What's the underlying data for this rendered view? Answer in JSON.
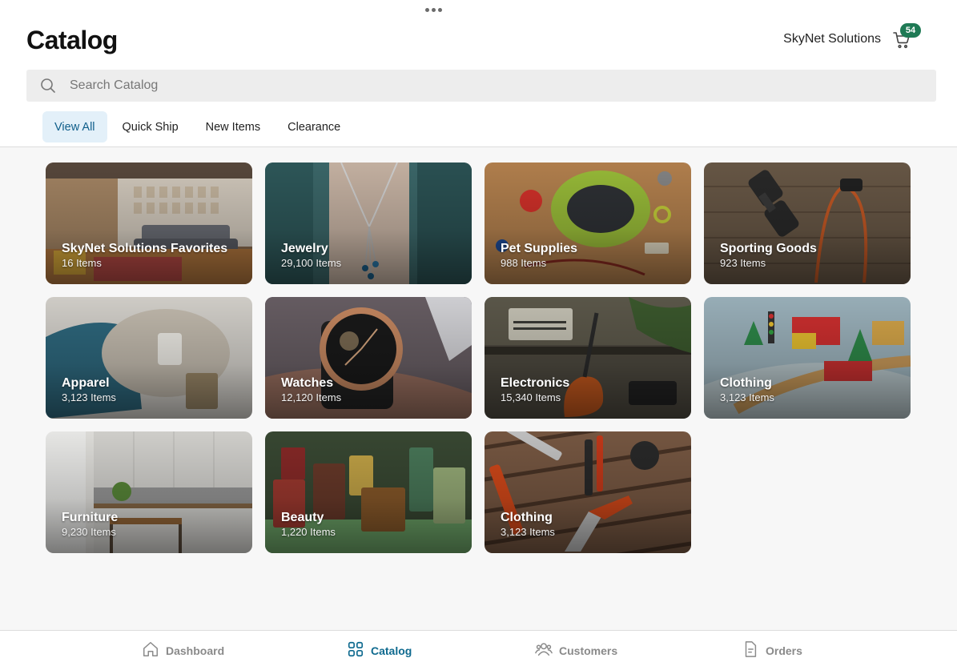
{
  "header": {
    "title": "Catalog",
    "company": "SkyNet Solutions",
    "cart_count": "54"
  },
  "search": {
    "placeholder": "Search Catalog"
  },
  "tabs": [
    {
      "label": "View All",
      "active": true
    },
    {
      "label": "Quick Ship",
      "active": false
    },
    {
      "label": "New Items",
      "active": false
    },
    {
      "label": "Clearance",
      "active": false
    }
  ],
  "categories": [
    {
      "name": "SkyNet Solutions Favorites",
      "count": "16 Items",
      "image": "living-room"
    },
    {
      "name": "Jewelry",
      "count": "29,100 Items",
      "image": "necklace"
    },
    {
      "name": "Pet Supplies",
      "count": "988 Items",
      "image": "dog-bed"
    },
    {
      "name": "Sporting Goods",
      "count": "923 Items",
      "image": "dumbbells"
    },
    {
      "name": "Apparel",
      "count": "3,123 Items",
      "image": "sweater-jeans"
    },
    {
      "name": "Watches",
      "count": "12,120 Items",
      "image": "wristwatch"
    },
    {
      "name": "Electronics",
      "count": "15,340 Items",
      "image": "guitar-amp"
    },
    {
      "name": "Clothing",
      "count": "3,123 Items",
      "image": "toy-train"
    },
    {
      "name": "Furniture",
      "count": "9,230 Items",
      "image": "kitchen"
    },
    {
      "name": "Beauty",
      "count": "1,220 Items",
      "image": "perfume"
    },
    {
      "name": "Clothing",
      "count": "3,123 Items",
      "image": "tools"
    }
  ],
  "nav": [
    {
      "label": "Dashboard",
      "icon": "home-icon",
      "active": false
    },
    {
      "label": "Catalog",
      "icon": "grid-icon",
      "active": true
    },
    {
      "label": "Customers",
      "icon": "people-icon",
      "active": false
    },
    {
      "label": "Orders",
      "icon": "document-icon",
      "active": false
    }
  ],
  "colors": {
    "accent": "#0f6a8f",
    "tab_active_bg": "#e3f0f9",
    "badge": "#1f7a55",
    "search_bg": "#ededed",
    "content_bg": "#f7f7f7"
  }
}
